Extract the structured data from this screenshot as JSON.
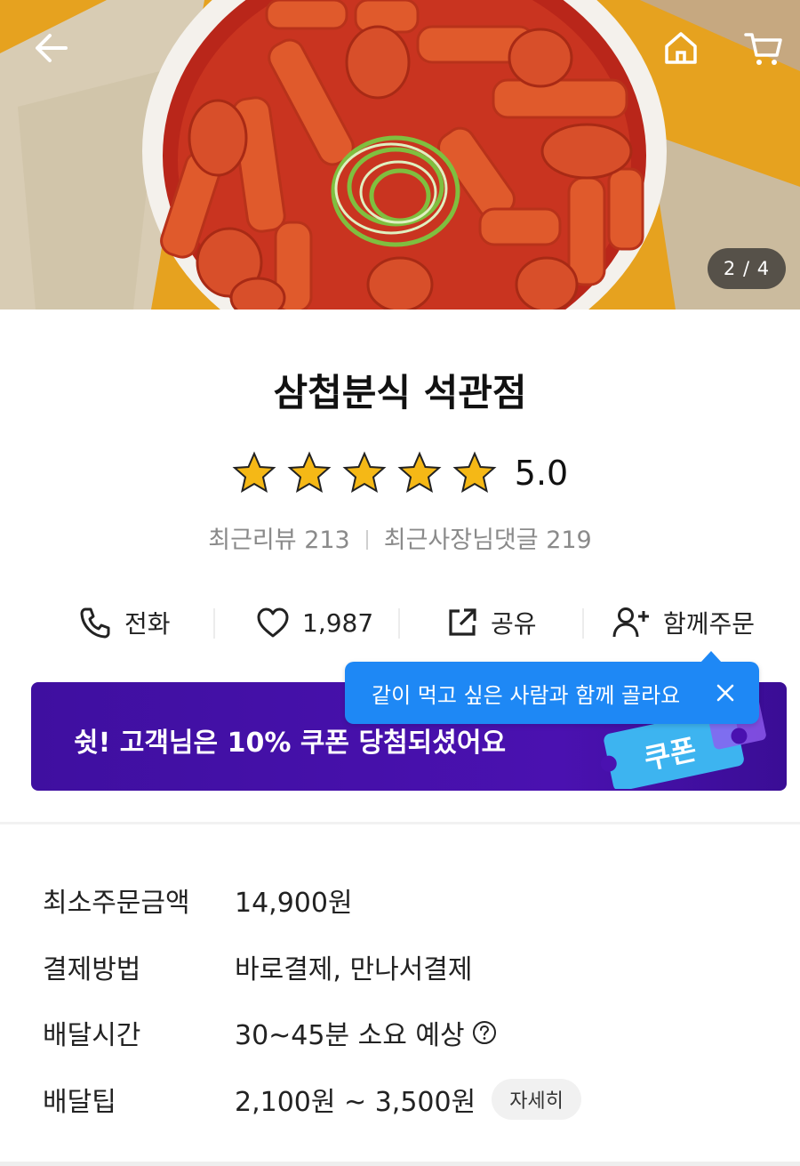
{
  "hero": {
    "counter": "2 / 4"
  },
  "store": {
    "name": "삼첩분식 석관점",
    "rating": 5.0,
    "rating_text": "5.0",
    "stars_filled": 5,
    "recent_reviews": "최근리뷰 213",
    "owner_comments": "최근사장님댓글 219"
  },
  "actions": {
    "call": "전화",
    "like": "1,987",
    "share": "공유",
    "group": "함께주문"
  },
  "tooltip": {
    "text": "같이 먹고 싶은 사람과 함께 골라요"
  },
  "coupon": {
    "text": "쉿! 고객님은 10% 쿠폰 당첨되셨어요",
    "ticket_label": "쿠폰"
  },
  "info": {
    "rows": [
      {
        "label": "최소주문금액",
        "value": "14,900원"
      },
      {
        "label": "결제방법",
        "value": "바로결제, 만나서결제"
      },
      {
        "label": "배달시간",
        "value": "30~45분 소요 예상"
      },
      {
        "label": "배달팁",
        "value": "2,100원 ~ 3,500원"
      }
    ],
    "detail_button": "자세히"
  },
  "colors": {
    "tooltip": "#1e88f5",
    "coupon_bg": "#4a11b0",
    "star": "#f5b816"
  },
  "icons": [
    "back-arrow-icon",
    "home-icon",
    "cart-icon",
    "phone-icon",
    "heart-icon",
    "share-icon",
    "add-person-icon",
    "close-icon",
    "help-icon",
    "star-icon"
  ]
}
